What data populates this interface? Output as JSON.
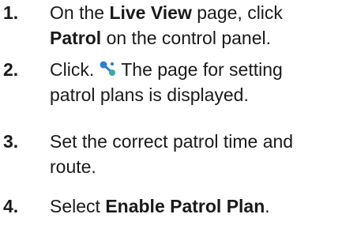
{
  "steps": [
    {
      "num": "1.",
      "line1_pre": "On the ",
      "line1_bold": "Live View",
      "line1_post": " page, click",
      "line2_bold": "Patrol",
      "line2_post": " on the control panel."
    },
    {
      "num": "2.",
      "line1_pre": "Click.",
      "icon": "patrol-icon",
      "line1_post": "The page for setting",
      "line2": "patrol plans is displayed."
    },
    {
      "num": "3.",
      "line1": "Set the correct patrol time and",
      "line2": "route."
    },
    {
      "num": "4.",
      "line1_pre": "Select ",
      "line1_bold": "Enable Patrol Plan",
      "line1_post": "."
    }
  ],
  "colors": {
    "text": "#1a1a1a",
    "icon_blue": "#2f7fd0",
    "icon_teal": "#3fa7a0"
  }
}
